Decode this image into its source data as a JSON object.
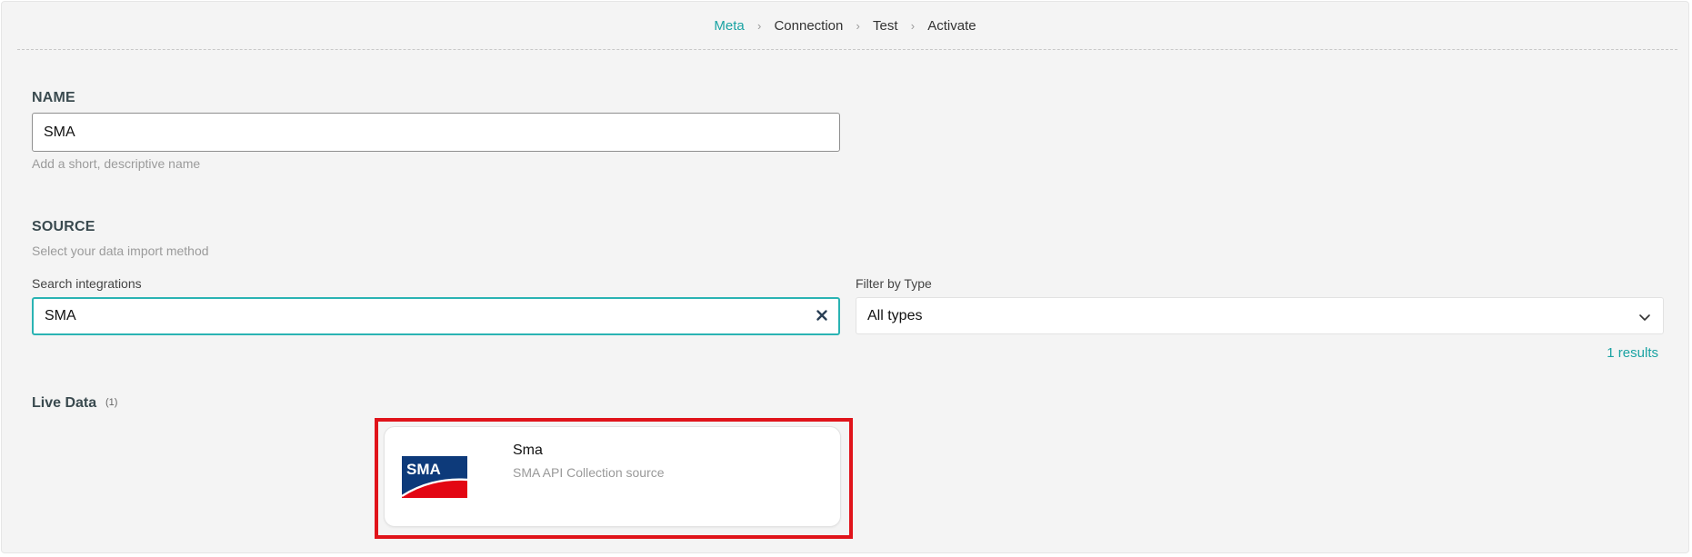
{
  "steps": [
    {
      "label": "Meta",
      "active": true
    },
    {
      "label": "Connection",
      "active": false
    },
    {
      "label": "Test",
      "active": false
    },
    {
      "label": "Activate",
      "active": false
    }
  ],
  "step_separator": "›",
  "name_section": {
    "title": "NAME",
    "value": "SMA",
    "help": "Add a short, descriptive name"
  },
  "source_section": {
    "title": "SOURCE",
    "help": "Select your data import method",
    "search_label": "Search integrations",
    "search_value": "SMA",
    "filter_label": "Filter by Type",
    "filter_value": "All types",
    "results": "1 results"
  },
  "live_data": {
    "title": "Live Data",
    "count": "(1)",
    "cards": [
      {
        "title": "Sma",
        "description": "SMA API Collection source",
        "logo_text": "SMA",
        "logo_icon": "sma-logo-icon"
      }
    ]
  },
  "colors": {
    "accent": "#1aa3a3",
    "highlight": "#e0131a",
    "sma_blue": "#0d3a7a",
    "sma_red": "#e30613"
  }
}
